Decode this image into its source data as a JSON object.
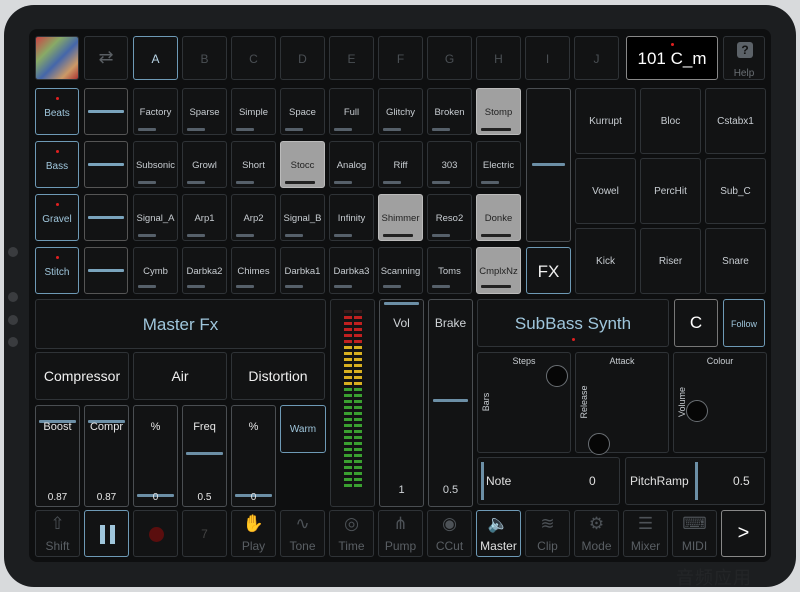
{
  "scene_letters": [
    "A",
    "B",
    "C",
    "D",
    "E",
    "F",
    "G",
    "H",
    "I",
    "J"
  ],
  "tempo_key": "101 C_m",
  "help_label": "Help",
  "tracks": [
    {
      "name": "Beats",
      "clips": [
        "Factory",
        "Sparse",
        "Simple",
        "Space",
        "Full",
        "Glitchy",
        "Broken",
        "Stomp"
      ]
    },
    {
      "name": "Bass",
      "clips": [
        "Subsonic",
        "Growl",
        "Short",
        "Stocc",
        "Analog",
        "Riff",
        "303",
        "Electric"
      ]
    },
    {
      "name": "Gravel",
      "clips": [
        "Signal_A",
        "Arp1",
        "Arp2",
        "Signal_B",
        "Infinity",
        "Shimmer",
        "Reso2",
        "Donke"
      ]
    },
    {
      "name": "Stitch",
      "clips": [
        "Cymb",
        "Darbka2",
        "Chimes",
        "Darbka1",
        "Darbka3",
        "Scanning",
        "Toms",
        "CmplxNz"
      ]
    }
  ],
  "fx_button": "FX",
  "pads": [
    "Kurrupt",
    "Bloc",
    "Cstabx1",
    "Vowel",
    "PercHit",
    "Sub_C",
    "Kick",
    "Riser",
    "Snare"
  ],
  "master_fx": {
    "title": "Master Fx",
    "effects": [
      "Compressor",
      "Air",
      "Distortion"
    ],
    "knobs": [
      {
        "label": "Boost",
        "value": "0.87"
      },
      {
        "label": "Compr",
        "value": "0.87"
      },
      {
        "label": "%",
        "value": "0"
      },
      {
        "label": "Freq",
        "value": "0.5"
      },
      {
        "label": "%",
        "value": "0"
      }
    ],
    "warm_label": "Warm"
  },
  "vol": {
    "label": "Vol",
    "value": "1"
  },
  "brake": {
    "label": "Brake",
    "value": "0.5"
  },
  "synth": {
    "title": "SubBass Synth",
    "key": "C",
    "follow": "Follow",
    "xy": [
      {
        "top": "Steps",
        "side": "Bars"
      },
      {
        "top": "Attack",
        "side": "Release"
      },
      {
        "top": "Colour",
        "side": "Volume"
      }
    ],
    "note": {
      "label": "Note",
      "value": "0"
    },
    "pitchramp": {
      "label": "PitchRamp",
      "value": "0.5"
    }
  },
  "toolbar": [
    {
      "icon": "⇧",
      "label": "Shift"
    },
    {
      "icon": "",
      "label": ""
    },
    {
      "icon": "",
      "label": ""
    },
    {
      "icon": "7",
      "label": ""
    },
    {
      "icon": "✋",
      "label": "Play"
    },
    {
      "icon": "∿",
      "label": "Tone"
    },
    {
      "icon": "◎",
      "label": "Time"
    },
    {
      "icon": "⋔",
      "label": "Pump"
    },
    {
      "icon": "◉",
      "label": "CCut"
    },
    {
      "icon": "🔈",
      "label": "Master"
    },
    {
      "icon": "≋",
      "label": "Clip"
    },
    {
      "icon": "⚙",
      "label": "Mode"
    },
    {
      "icon": "☰",
      "label": "Mixer"
    },
    {
      "icon": "⌨",
      "label": "MIDI"
    },
    {
      "icon": ">",
      "label": ""
    }
  ],
  "watermark": "音频应用"
}
